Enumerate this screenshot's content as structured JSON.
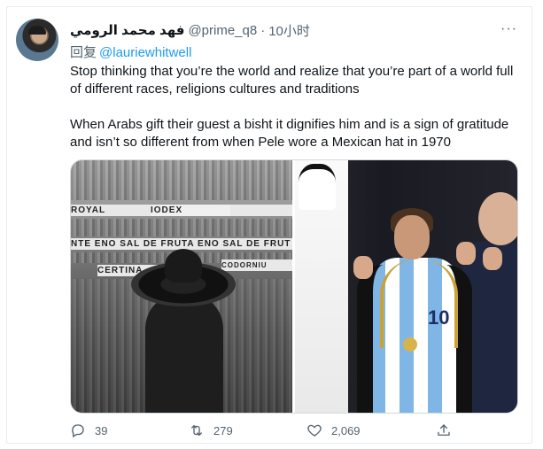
{
  "tweet": {
    "display_name": "فهد محمد الرومي",
    "handle": "@prime_q8",
    "separator": "·",
    "time": "10小时",
    "replying_label": "回复",
    "replying_to": "@lauriewhitwell",
    "paragraphs": [
      "Stop thinking that you’re the world and realize that you’re part of a world full of different races, religions cultures and traditions",
      "When Arabs gift their guest a bisht it dignifies him and is a sign of gratitude and isn’t so different from when Pele wore a Mexican hat in 1970"
    ],
    "more_label": "···"
  },
  "media": {
    "left_banners": [
      "ROYAL",
      "IODEX",
      "NTE  ENO SAL DE FRUTA  ENO SAL DE FRUT",
      "CERTINA",
      "CODORNIU"
    ],
    "right_shirt_number": "10"
  },
  "actions": {
    "reply_count": "39",
    "retweet_count": "279",
    "like_count": "2,069"
  },
  "icons": {
    "reply": "reply-icon",
    "retweet": "retweet-icon",
    "like": "heart-icon",
    "share": "share-icon",
    "more": "more-dots-icon"
  },
  "colors": {
    "link": "#1d9bf0",
    "secondary_text": "#536471",
    "primary_text": "#0f1419"
  }
}
